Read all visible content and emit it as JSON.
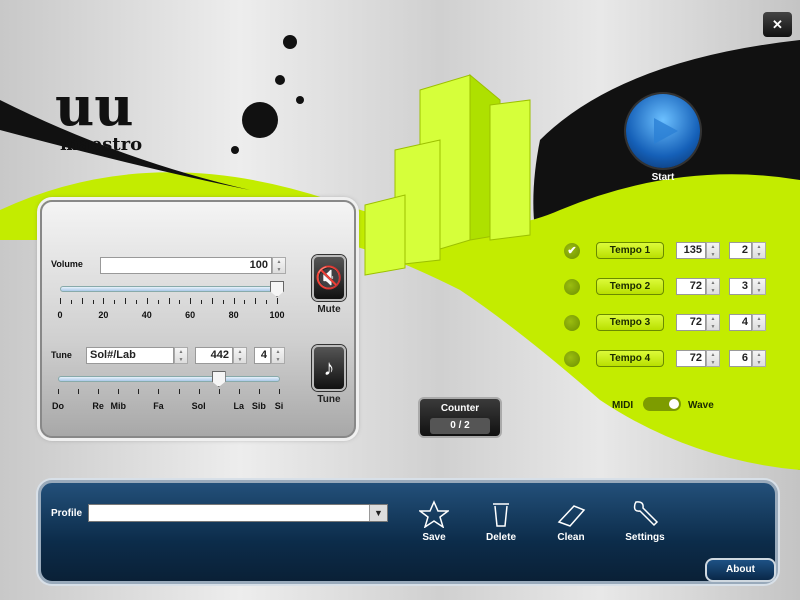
{
  "window": {
    "close_label": "✕",
    "logo_text": "Maestro"
  },
  "start": {
    "label": "Start",
    "icon": "play-icon"
  },
  "volume": {
    "label": "Volume",
    "value": "100",
    "slider_value": 100,
    "ticks": [
      "0",
      "20",
      "40",
      "60",
      "80",
      "100"
    ]
  },
  "mute": {
    "label": "Mute",
    "icon": "speaker-mute-icon"
  },
  "tune": {
    "label": "Tune",
    "note": "Sol#/Lab",
    "frequency": "442",
    "octave": "4",
    "slider_index": 8,
    "ticks": [
      "Do",
      "Re",
      "Mib",
      "Fa",
      "Sol",
      "La",
      "Sib",
      "Si"
    ],
    "button_label": "Tune",
    "icon": "music-note-icon"
  },
  "tempos": [
    {
      "label": "Tempo 1",
      "bpm": "135",
      "beats": "2",
      "selected": true
    },
    {
      "label": "Tempo 2",
      "bpm": "72",
      "beats": "3",
      "selected": false
    },
    {
      "label": "Tempo 3",
      "bpm": "72",
      "beats": "4",
      "selected": false
    },
    {
      "label": "Tempo 4",
      "bpm": "72",
      "beats": "6",
      "selected": false
    }
  ],
  "mode": {
    "left": "MIDI",
    "right": "Wave",
    "selected": "Wave"
  },
  "counter": {
    "label": "Counter",
    "value": "0 / 2"
  },
  "profile": {
    "label": "Profile",
    "value": ""
  },
  "toolbar": {
    "save": "Save",
    "delete": "Delete",
    "clean": "Clean",
    "settings": "Settings"
  },
  "about": "About",
  "colors": {
    "accent": "#c8f000",
    "bar": "#0c2c4a"
  }
}
